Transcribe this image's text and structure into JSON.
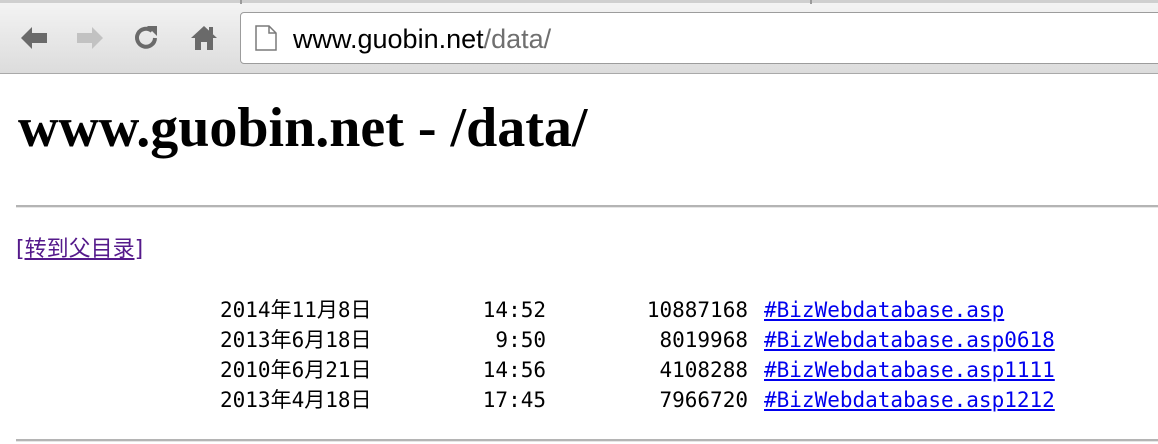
{
  "browser": {
    "url_host": "www.guobin.net",
    "url_path": "/data/"
  },
  "page": {
    "title": "www.guobin.net - /data/",
    "parent_link": "[转到父目录]"
  },
  "files": [
    {
      "date": "2014年11月8日",
      "time": "14:52",
      "size": "10887168",
      "name": "#BizWebdatabase.asp"
    },
    {
      "date": "2013年6月18日",
      "time": "9:50",
      "size": "8019968",
      "name": "#BizWebdatabase.asp0618"
    },
    {
      "date": "2010年6月21日",
      "time": "14:56",
      "size": "4108288",
      "name": "#BizWebdatabase.asp1111"
    },
    {
      "date": "2013年4月18日",
      "time": "17:45",
      "size": "7966720",
      "name": "#BizWebdatabase.asp1212"
    }
  ]
}
